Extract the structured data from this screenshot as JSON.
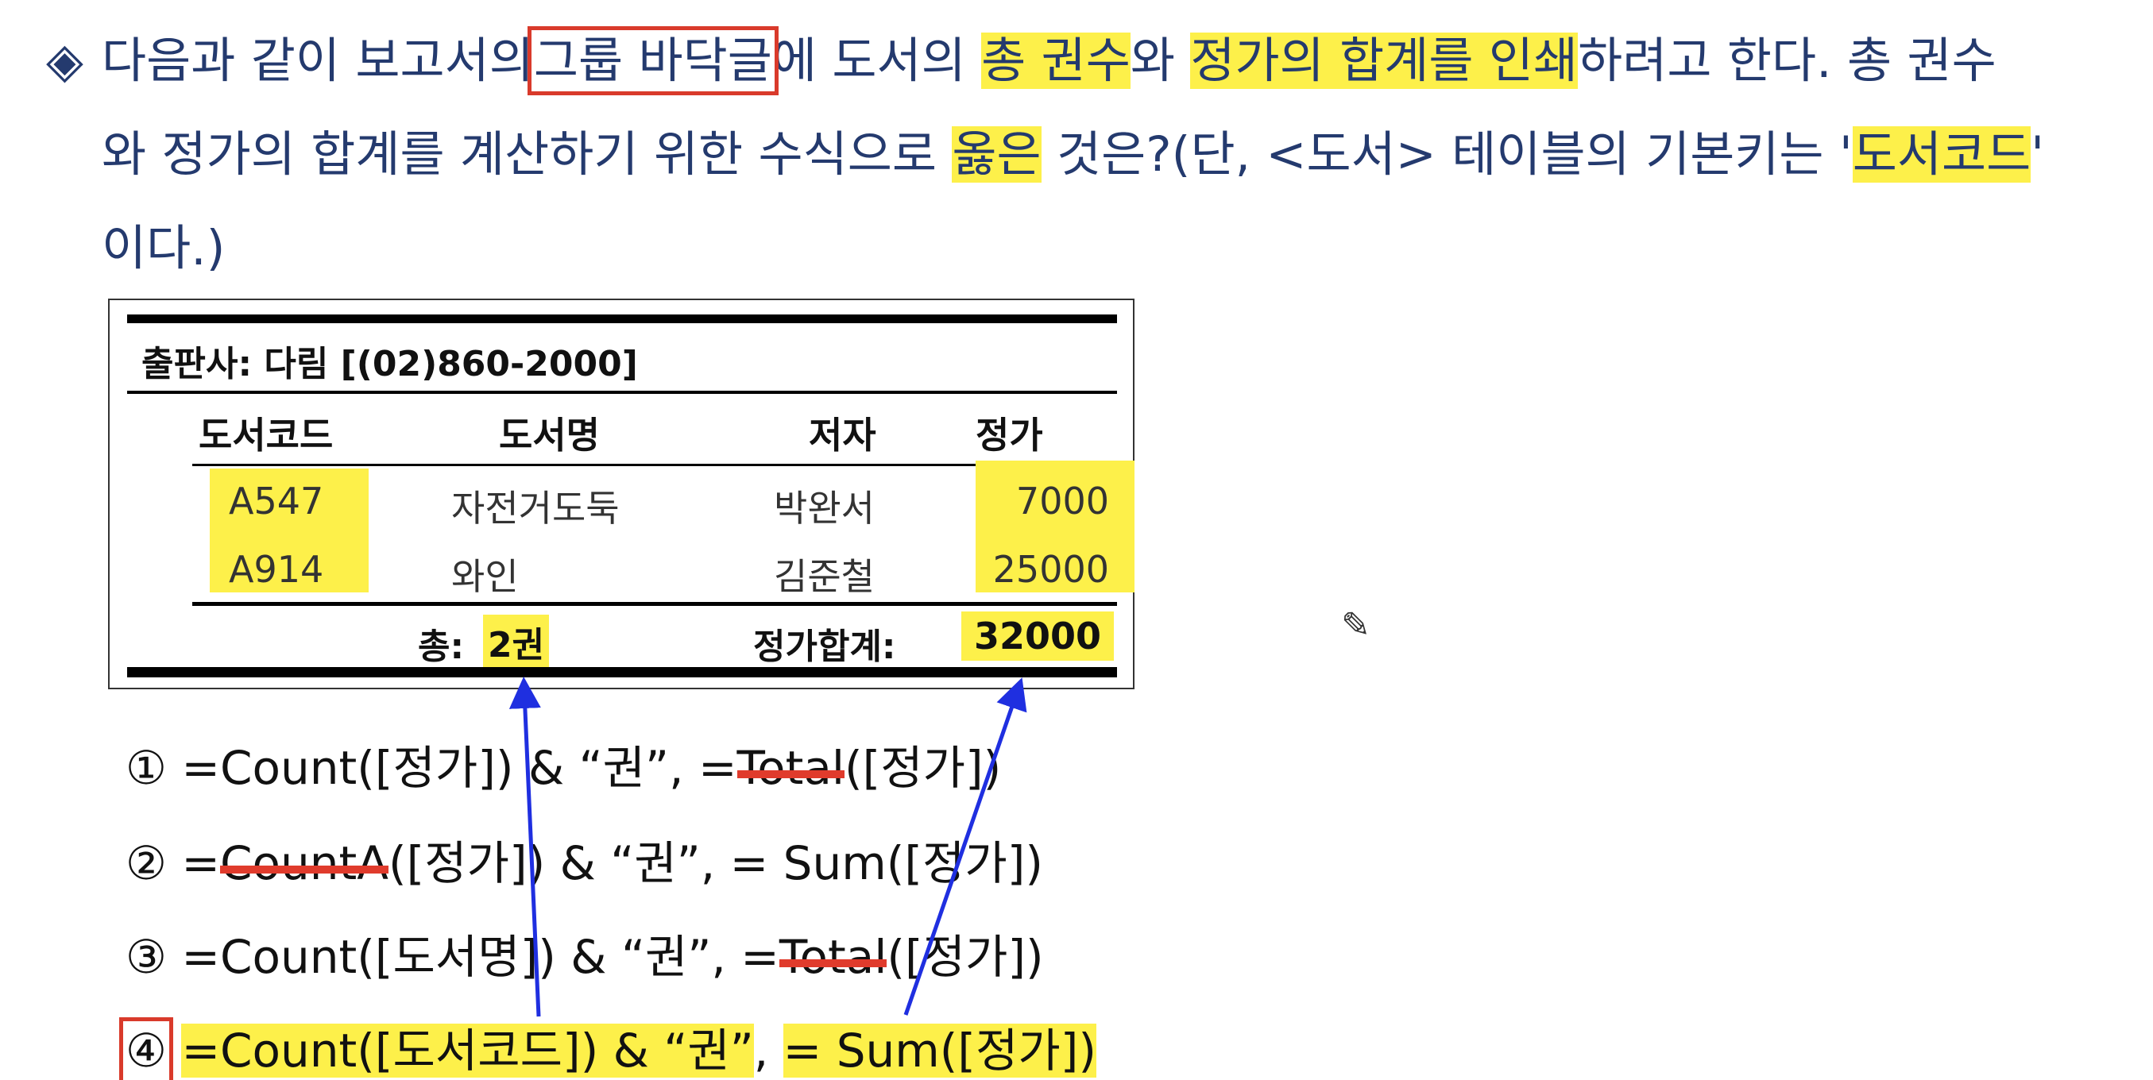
{
  "question": {
    "marker": "◈",
    "line1": {
      "a": "다음과 같이 보고서의",
      "b": "그룹 바닥글",
      "c": "에 도서의",
      "d": "총 권수",
      "e": "와",
      "f": "정가의 합계를 인쇄",
      "g": "하려고 한다. 총 권수"
    },
    "line2": {
      "a": "와 정가의 합계를 계산하기 위한 수식으로",
      "b": "옳은",
      "c": "것은?(단, <도서> 테이블의 기본키는 '",
      "d": "도서코드",
      "e": "'"
    },
    "line3": "이다.)"
  },
  "report": {
    "publisher": "출판사:  다림 [(02)860-2000]",
    "headers": [
      "도서코드",
      "도서명",
      "저자",
      "정가"
    ],
    "rows": [
      {
        "code": "A547",
        "title": "자전거도둑",
        "author": "박완서",
        "price": "7000"
      },
      {
        "code": "A914",
        "title": "와인",
        "author": "김준철",
        "price": "25000"
      }
    ],
    "footer": {
      "total_label": "총:",
      "total_value": "2권",
      "sum_label": "정가합계:",
      "sum_value": "32000"
    }
  },
  "choices": [
    {
      "num": "①",
      "a": " =Count([정가]) & “권”, =",
      "strike": "Total",
      "b": "([정가])"
    },
    {
      "num": "②",
      "a": " =",
      "strike": "CountA",
      "b": "([정가]) & “권”, = Sum([정가])"
    },
    {
      "num": "③",
      "a": " =Count([도서명]) & “권”, =",
      "strike": "Total",
      "b": "([정가])"
    },
    {
      "num": "④",
      "a": " ",
      "h1": "=Count([도서코드]) & “권”",
      "b": ", ",
      "h2": "= Sum([정가])"
    }
  ],
  "colors": {
    "question_text": "#243a6e",
    "highlight": "#fdf04a",
    "red_mark": "#d93a2b",
    "arrow_blue": "#1f2fe0"
  },
  "icons": [
    "pencil-cursor-icon"
  ]
}
